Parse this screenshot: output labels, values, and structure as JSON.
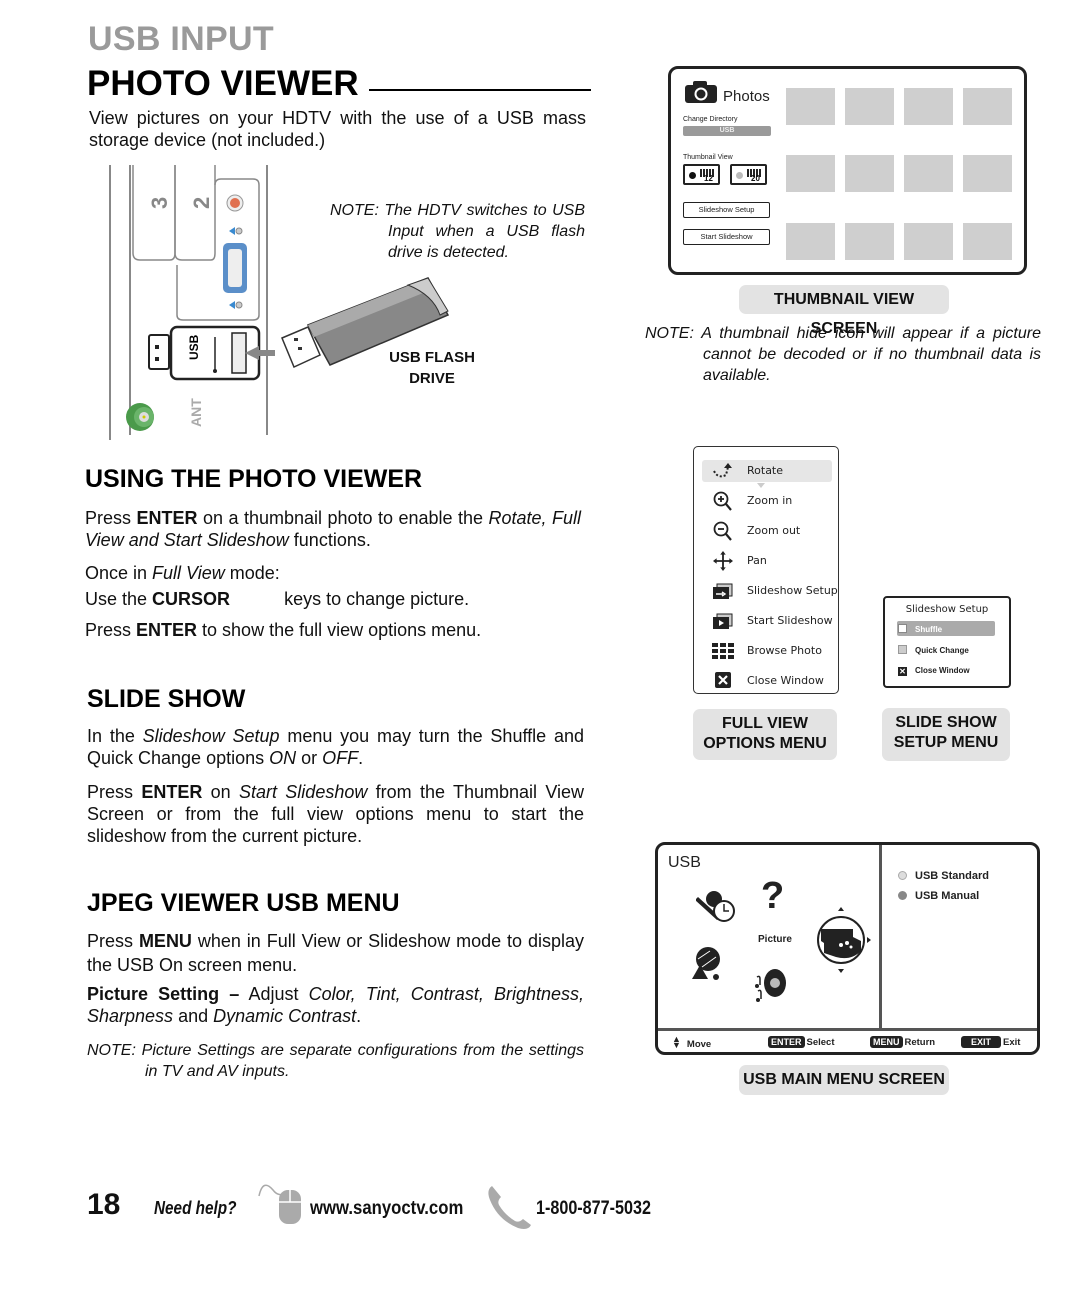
{
  "header": {
    "kicker": "USB INPUT",
    "title": "PHOTO VIEWER",
    "intro": "View pictures on your HDTV with the use of a USB mass storage device (not included.)"
  },
  "connector_panel": {
    "port_labels": [
      "3",
      "2"
    ],
    "usb_label": "USB",
    "ant_label": "ANT"
  },
  "notes": {
    "switch_note_prefix": "NOTE:",
    "switch_note_body": "The HDTV switches to USB Input when a USB flash drive is detected.",
    "thumb_note_prefix": "NOTE:",
    "thumb_note_body": "A thumbnail hide icon will appear if a picture cannot be decoded or if no thumbnail data is available.",
    "settings_note_prefix": "NOTE:",
    "settings_note_body": "Picture Settings are separate configurations from the settings in TV and AV inputs."
  },
  "flash_drive_label": [
    "USB FLASH",
    "DRIVE"
  ],
  "thumbnail_screen": {
    "title": "Photos",
    "change_directory_label": "Change Directory",
    "directory_value": "USB",
    "thumbnail_view_label": "Thumbnail View",
    "view_options": [
      {
        "count": "12",
        "selected": true
      },
      {
        "count": "20",
        "selected": false
      }
    ],
    "buttons": [
      "Slideshow Setup",
      "Start Slideshow"
    ],
    "thumbnail_rows": 3,
    "thumbnail_cols": 4,
    "caption": "THUMBNAIL VIEW SCREEN"
  },
  "using_section": {
    "heading": "USING THE PHOTO VIEWER",
    "p1_a": "Press ",
    "p1_b": "ENTER",
    "p1_c": " on a thumbnail photo to enable the ",
    "p1_d": "Rotate, Full View and Start Slideshow",
    "p1_e": " functions.",
    "p2_a": "Once in ",
    "p2_b": "Full View",
    "p2_c": " mode:",
    "p3_a": "Use the ",
    "p3_b": "CURSOR",
    "p3_c": "keys to change picture.",
    "p4_a": "Press ",
    "p4_b": "ENTER",
    "p4_c": " to show the full view options menu."
  },
  "full_view_menu": {
    "items": [
      {
        "label": "Rotate",
        "icon": "rotate-icon",
        "highlighted": true
      },
      {
        "label": "Zoom in",
        "icon": "zoom-in-icon"
      },
      {
        "label": "Zoom out",
        "icon": "zoom-out-icon"
      },
      {
        "label": "Pan",
        "icon": "pan-icon"
      },
      {
        "label": "Slideshow Setup",
        "icon": "slideshow-setup-icon"
      },
      {
        "label": "Start Slideshow",
        "icon": "start-slideshow-icon"
      },
      {
        "label": "Browse Photo",
        "icon": "grid-icon"
      },
      {
        "label": "Close Window",
        "icon": "close-icon"
      }
    ],
    "caption": [
      "FULL VIEW",
      "OPTIONS MENU"
    ]
  },
  "slideshow_setup_menu": {
    "title": "Slideshow Setup",
    "items": [
      {
        "label": "Shuffle",
        "highlighted": true
      },
      {
        "label": "Quick Change"
      },
      {
        "label": "Close Window",
        "icon": "close-icon"
      }
    ],
    "caption": [
      "SLIDE SHOW",
      "SETUP MENU"
    ]
  },
  "slide_show_section": {
    "heading": "SLIDE SHOW",
    "p1_a": "In the ",
    "p1_b": "Slideshow Setup",
    "p1_c": " menu you may turn the Shuffle and Quick Change options ",
    "p1_d": "ON",
    "p1_e": " or ",
    "p1_f": "OFF",
    "p1_g": ".",
    "p2_a": "Press ",
    "p2_b": "ENTER",
    "p2_c": " on ",
    "p2_d": "Start Slideshow",
    "p2_e": " from the Thumbnail View Screen or from the full view options menu to start the slideshow from the current picture."
  },
  "jpeg_section": {
    "heading": "JPEG VIEWER USB MENU",
    "p1_a": "Press ",
    "p1_b": "MENU",
    "p1_c": " when in Full View or Slideshow mode to display the USB On screen menu.",
    "p2_a": "Picture Setting –",
    "p2_b": " Adjust ",
    "p2_c": "Color, Tint, Contrast, Brightness, Sharpness",
    "p2_d": " and ",
    "p2_e": "Dynamic Contrast",
    "p2_f": "."
  },
  "usb_main_menu": {
    "title": "USB",
    "center_label": "Picture",
    "options": [
      {
        "label": "USB Standard",
        "color": "#dddddd"
      },
      {
        "label": "USB Manual",
        "color": "#888888"
      }
    ],
    "footer": {
      "move": "Move",
      "enter_key": "ENTER",
      "enter_action": "Select",
      "menu_key": "MENU",
      "menu_action": "Return",
      "exit_key": "EXIT",
      "exit_action": "Exit"
    },
    "caption": "USB MAIN MENU SCREEN"
  },
  "page_footer": {
    "page_number": "18",
    "need_help": "Need help?",
    "website": "www.sanyoctv.com",
    "phone": "1-800-877-5032"
  },
  "colors": {
    "kicker_gray": "#9a9a9a",
    "caption_bg": "#e3e3e3",
    "thumb_gray": "#cfcfcf",
    "vga_blue": "#5b8fc9",
    "ant_green": "#4a9a4a",
    "audio_red": "#e07050"
  }
}
